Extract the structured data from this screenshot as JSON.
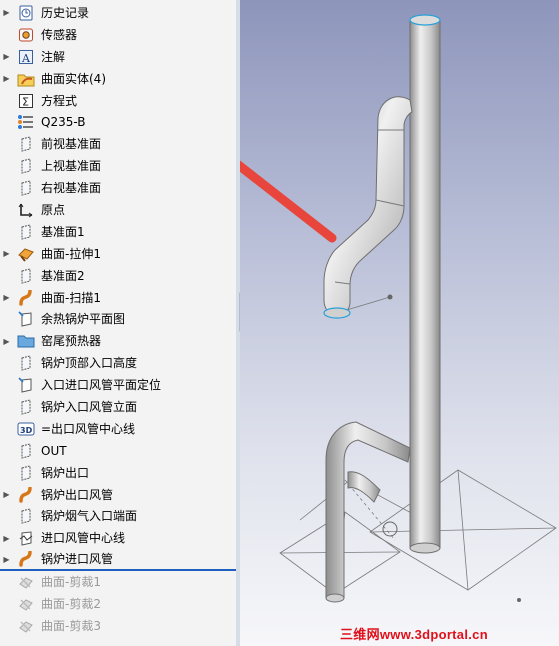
{
  "feature_tree": {
    "items": [
      {
        "label": "历史记录",
        "icon": "history-icon",
        "expandable": true,
        "state": "normal"
      },
      {
        "label": "传感器",
        "icon": "sensor-icon",
        "expandable": false,
        "state": "normal"
      },
      {
        "label": "注解",
        "icon": "annotation-icon",
        "expandable": true,
        "state": "normal"
      },
      {
        "label": "曲面实体(4)",
        "icon": "surface-bodies-folder-icon",
        "expandable": true,
        "state": "normal"
      },
      {
        "label": "方程式",
        "icon": "equations-icon",
        "expandable": false,
        "state": "normal"
      },
      {
        "label": "Q235-B",
        "icon": "material-icon",
        "expandable": false,
        "state": "normal"
      },
      {
        "label": "前视基准面",
        "icon": "plane-icon",
        "expandable": false,
        "state": "normal"
      },
      {
        "label": "上视基准面",
        "icon": "plane-icon",
        "expandable": false,
        "state": "normal"
      },
      {
        "label": "右视基准面",
        "icon": "plane-icon",
        "expandable": false,
        "state": "normal"
      },
      {
        "label": "原点",
        "icon": "origin-icon",
        "expandable": false,
        "state": "normal"
      },
      {
        "label": "基准面1",
        "icon": "plane-icon",
        "expandable": false,
        "state": "normal"
      },
      {
        "label": "曲面-拉伸1",
        "icon": "surface-extrude-icon",
        "expandable": true,
        "state": "normal"
      },
      {
        "label": "基准面2",
        "icon": "plane-icon",
        "expandable": false,
        "state": "normal"
      },
      {
        "label": "曲面-扫描1",
        "icon": "surface-sweep-icon",
        "expandable": true,
        "state": "normal"
      },
      {
        "label": "余热锅炉平面图",
        "icon": "sketch-icon",
        "expandable": false,
        "state": "normal"
      },
      {
        "label": "窑尾预热器",
        "icon": "folder-icon",
        "expandable": true,
        "state": "normal"
      },
      {
        "label": "锅炉顶部入口高度",
        "icon": "plane-icon",
        "expandable": false,
        "state": "normal"
      },
      {
        "label": "入口进口风管平面定位",
        "icon": "sketch-icon",
        "expandable": false,
        "state": "normal"
      },
      {
        "label": "锅炉入口风管立面",
        "icon": "plane-icon",
        "expandable": false,
        "state": "normal"
      },
      {
        "label": "=出口风管中心线",
        "icon": "3d-sketch-icon",
        "expandable": false,
        "state": "normal"
      },
      {
        "label": "OUT",
        "icon": "plane-icon",
        "expandable": false,
        "state": "normal"
      },
      {
        "label": "锅炉出口",
        "icon": "plane-icon",
        "expandable": false,
        "state": "normal"
      },
      {
        "label": "锅炉出口风管",
        "icon": "surface-sweep-icon",
        "expandable": true,
        "state": "normal"
      },
      {
        "label": "锅炉烟气入口端面",
        "icon": "plane-icon",
        "expandable": false,
        "state": "normal"
      },
      {
        "label": "进口风管中心线",
        "icon": "sketch-line-icon",
        "expandable": true,
        "state": "normal"
      },
      {
        "label": "锅炉进口风管",
        "icon": "surface-sweep-icon",
        "expandable": true,
        "state": "rollback"
      },
      {
        "label": "曲面-剪裁1",
        "icon": "surface-trim-icon",
        "expandable": false,
        "state": "dim"
      },
      {
        "label": "曲面-剪裁2",
        "icon": "surface-trim-icon",
        "expandable": false,
        "state": "dim"
      },
      {
        "label": "曲面-剪裁3",
        "icon": "surface-trim-icon",
        "expandable": false,
        "state": "dim"
      }
    ]
  },
  "viewport": {
    "annotation_arrow_color": "#e8453c",
    "model_color": "#c9c9c9"
  },
  "watermark": {
    "text": "三维网www.3dportal.cn"
  }
}
